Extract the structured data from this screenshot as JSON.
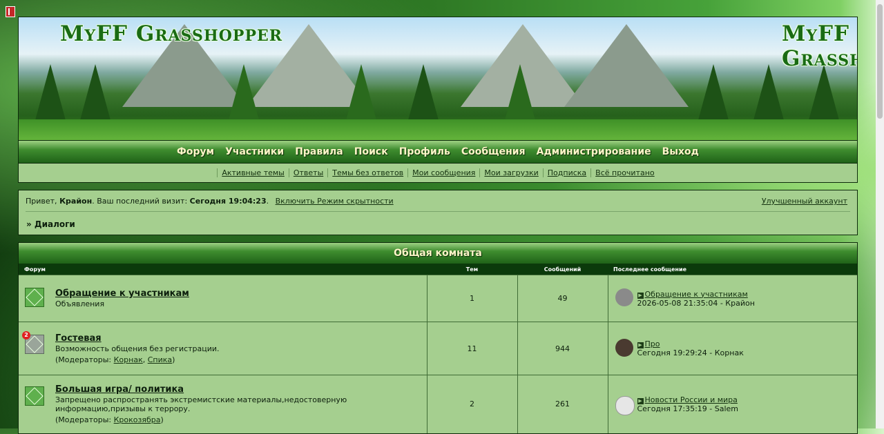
{
  "site": {
    "logo": "MyFF Grasshopper"
  },
  "nav": {
    "items": [
      "Форум",
      "Участники",
      "Правила",
      "Поиск",
      "Профиль",
      "Сообщения",
      "Администрирование",
      "Выход"
    ]
  },
  "subnav": {
    "items": [
      "Активные темы",
      "Ответы",
      "Темы без ответов",
      "Мои сообщения",
      "Мои загрузки",
      "Подписка",
      "Всё прочитано"
    ]
  },
  "info": {
    "greeting": "Привет, ",
    "user": "Крайон",
    "last_visit_label": ".  Ваш последний визит: ",
    "last_visit": "Сегодня 19:04:23",
    "hidden_mode": "Включить Режим скрытности",
    "premium": "Улучшенный аккаунт",
    "crumb": "» Диалоги"
  },
  "category": {
    "title": "Общая комната",
    "headers": {
      "forum": "Форум",
      "topics": "Тем",
      "posts": "Сообщений",
      "last": "Последнее сообщение"
    },
    "moderators_label": "(Модераторы: ",
    "forums": [
      {
        "name": "Обращение к участникам",
        "desc": "Объявления",
        "topics": "1",
        "posts": "49",
        "last_title": "Обращение к участникам",
        "last_meta": "2026-05-08 21:35:04 - Крайон"
      },
      {
        "name": "Гостевая",
        "desc": "Возможность общения без регистрации.",
        "mod1": "Корнак",
        "mod2": "Спика",
        "topics": "11",
        "posts": "944",
        "badge": "2",
        "last_title": "Про",
        "last_meta": "Сегодня 19:29:24 - Корнак"
      },
      {
        "name": "Большая игра/ политика",
        "desc": "Запрещено распространять экстремистские материалы,недостоверную информацию,призывы к террору.",
        "mod1": "Крокозябра",
        "topics": "2",
        "posts": "261",
        "last_title": "Новости России и мира",
        "last_meta": "Сегодня 17:35:19 - Salem"
      }
    ]
  }
}
